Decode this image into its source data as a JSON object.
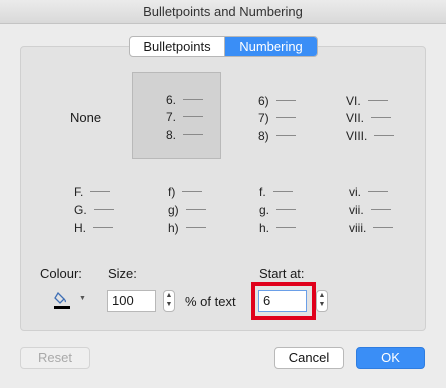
{
  "window": {
    "title": "Bulletpoints and Numbering"
  },
  "tabs": [
    {
      "label": "Bulletpoints",
      "active": false
    },
    {
      "label": "Numbering",
      "active": true
    }
  ],
  "styles": {
    "none_label": "None",
    "grid": [
      [
        "6.",
        "7.",
        "8."
      ],
      [
        "6)",
        "7)",
        "8)"
      ],
      [
        "VI.",
        "VII.",
        "VIII."
      ],
      [
        "F.",
        "G.",
        "H."
      ],
      [
        "f)",
        "g)",
        "h)"
      ],
      [
        "f.",
        "g.",
        "h."
      ],
      [
        "vi.",
        "vii.",
        "viii."
      ]
    ]
  },
  "format": {
    "colour_label": "Colour:",
    "colour_value": "#000000",
    "size_label": "Size:",
    "size_value": "100",
    "size_suffix": "% of text",
    "start_label": "Start at:",
    "start_value": "6"
  },
  "buttons": {
    "reset": "Reset",
    "cancel": "Cancel",
    "ok": "OK"
  },
  "accent_color": "#3a8ef6",
  "highlight_color": "#e0001b"
}
